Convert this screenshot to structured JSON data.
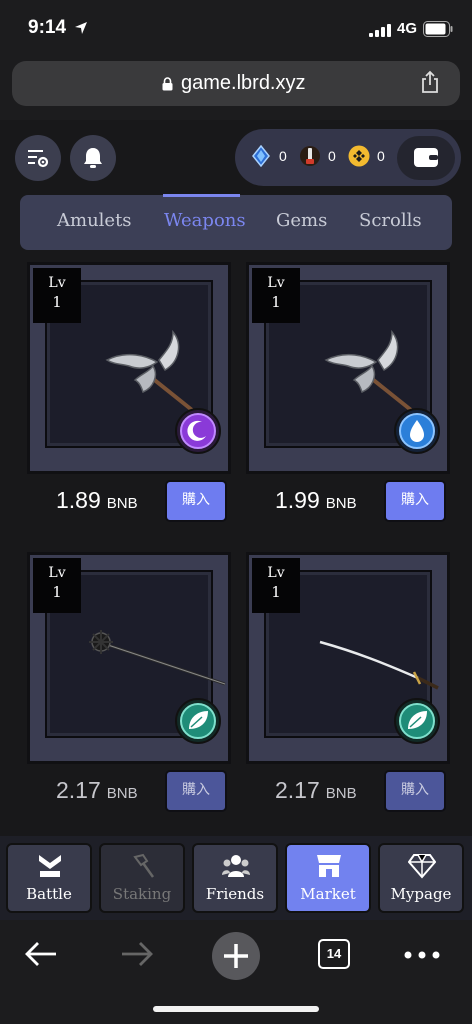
{
  "status_bar": {
    "time": "9:14",
    "network": "4G"
  },
  "browser": {
    "url": "game.lbrd.xyz",
    "tabs_count": "14"
  },
  "header": {
    "currencies": [
      {
        "icon": "blue-crystal-icon",
        "value": "0"
      },
      {
        "icon": "potion-icon",
        "value": "0"
      },
      {
        "icon": "bnb-coin-icon",
        "value": "0"
      }
    ]
  },
  "tabs": [
    {
      "label": "Amulets"
    },
    {
      "label": "Weapons",
      "active": true
    },
    {
      "label": "Gems"
    },
    {
      "label": "Scrolls"
    }
  ],
  "items": [
    {
      "lv_label": "Lv",
      "level": "1",
      "weapon": "double-blade-axe-icon",
      "element": "purple-moon-element-icon",
      "price": "1.89",
      "unit": "BNB",
      "buy_label": "購入"
    },
    {
      "lv_label": "Lv",
      "level": "1",
      "weapon": "double-blade-axe-icon",
      "element": "blue-water-element-icon",
      "price": "1.99",
      "unit": "BNB",
      "buy_label": "購入"
    },
    {
      "lv_label": "Lv",
      "level": "1",
      "weapon": "spiked-flail-icon",
      "element": "green-wind-element-icon",
      "price": "2.17",
      "unit": "BNB",
      "buy_label": "購入"
    },
    {
      "lv_label": "Lv",
      "level": "1",
      "weapon": "katana-icon",
      "element": "green-wind-element-icon",
      "price": "2.17",
      "unit": "BNB",
      "buy_label": "購入"
    }
  ],
  "nav": [
    {
      "label": "Battle",
      "icon": "battle-icon"
    },
    {
      "label": "Staking",
      "icon": "hammer-icon",
      "disabled": true
    },
    {
      "label": "Friends",
      "icon": "friends-icon"
    },
    {
      "label": "Market",
      "icon": "shop-icon",
      "active": true
    },
    {
      "label": "Mypage",
      "icon": "diamond-icon"
    }
  ],
  "colors": {
    "accent": "#7b86ef",
    "panel": "#3c3f56",
    "background": "#18181a"
  }
}
